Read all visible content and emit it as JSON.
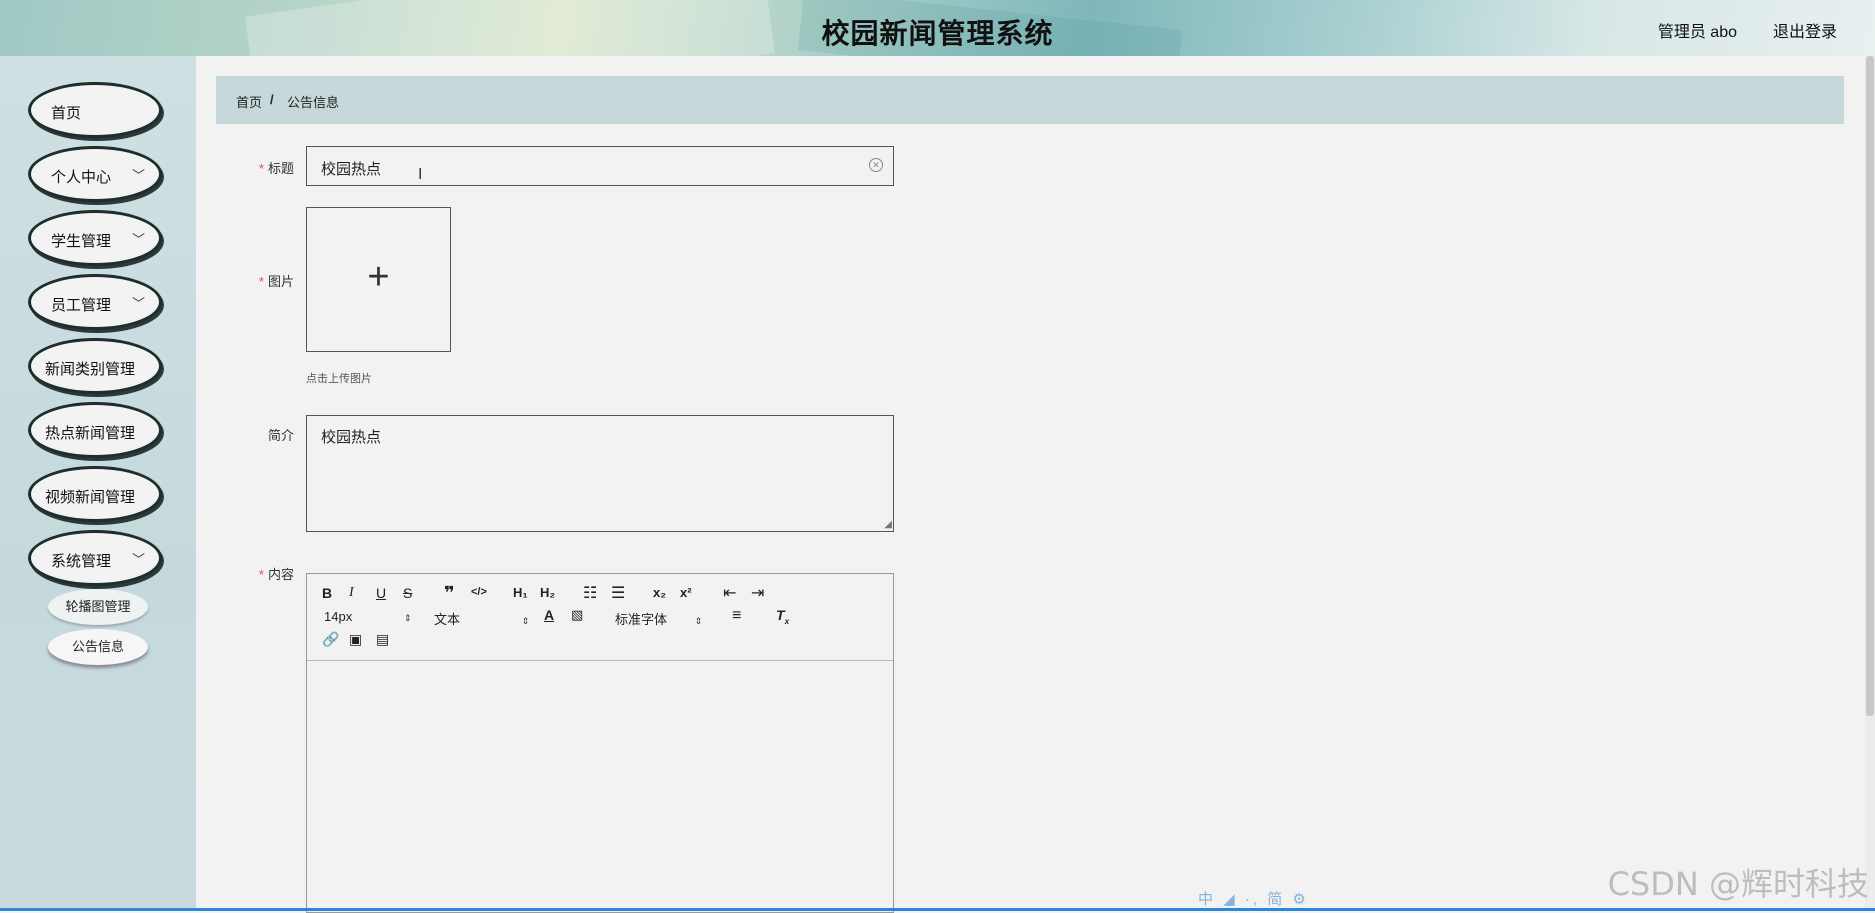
{
  "header": {
    "title": "校园新闻管理系统",
    "user_label": "管理员 abo",
    "logout_label": "退出登录"
  },
  "sidebar": {
    "items": [
      {
        "label": "首页",
        "has_chevron": false
      },
      {
        "label": "个人中心",
        "has_chevron": true
      },
      {
        "label": "学生管理",
        "has_chevron": true
      },
      {
        "label": "员工管理",
        "has_chevron": true
      },
      {
        "label": "新闻类别管理",
        "has_chevron": false
      },
      {
        "label": "热点新闻管理",
        "has_chevron": false
      },
      {
        "label": "视频新闻管理",
        "has_chevron": false
      },
      {
        "label": "系统管理",
        "has_chevron": true
      }
    ],
    "chevron_glyph": "﹀",
    "sub_items": [
      {
        "label": "轮播图管理"
      },
      {
        "label": "公告信息",
        "active": true
      }
    ]
  },
  "breadcrumb": {
    "home": "首页",
    "separator": "/",
    "current": "公告信息"
  },
  "form": {
    "required_mark": "*",
    "title_label": "标题",
    "title_value": "校园热点",
    "image_label": "图片",
    "upload_hint": "点击上传图片",
    "summary_label": "简介",
    "summary_value": "校园热点",
    "content_label": "内容"
  },
  "editor": {
    "font_size": "14px",
    "block_format": "文本",
    "font_family": "标准字体"
  },
  "watermark": "CSDN @辉时科技",
  "ime_bar": "中 ◢ ·,  简 ⚙"
}
